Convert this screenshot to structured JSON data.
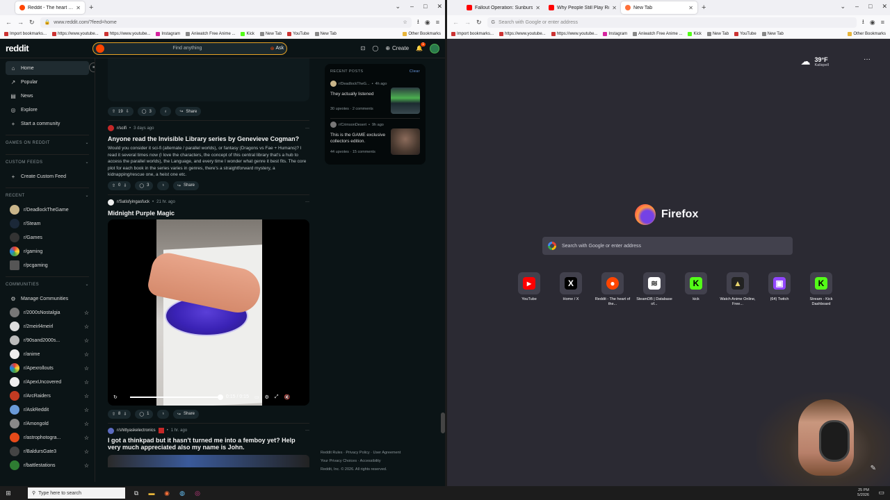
{
  "left_browser": {
    "tabs": [
      {
        "title": "Reddit - The heart of the internet",
        "active": true
      }
    ],
    "new_tab_symbol": "+",
    "url": "www.reddit.com/?feed=home",
    "bookmarks": [
      "Import bookmarks...",
      "https://www.youtube...",
      "https://www.youtube...",
      "Instagram",
      "Aniwatch Free Anime ...",
      "Kick",
      "New Tab",
      "YouTube",
      "New Tab"
    ],
    "other_bookmarks": "Other Bookmarks"
  },
  "reddit": {
    "logo": "reddit",
    "search_placeholder": "Find anything",
    "ask_label": "Ask",
    "create_label": "Create",
    "notif_count": "1",
    "sidebar": {
      "main": [
        "Home",
        "Popular",
        "News",
        "Explore",
        "Start a community"
      ],
      "games_header": "GAMES ON REDDIT",
      "custom_header": "CUSTOM FEEDS",
      "create_custom": "Create Custom Feed",
      "recent_header": "RECENT",
      "recent": [
        "r/DeadlockTheGame",
        "r/Steam",
        "r/Games",
        "r/gaming",
        "r/pcgaming"
      ],
      "communities_header": "COMMUNITIES",
      "manage": "Manage Communities",
      "communities": [
        "r/2000sNostalgia",
        "r/2meirl4meirl",
        "r/90sand2000s...",
        "r/anime",
        "r/Apexrollouts",
        "r/ApexUncovered",
        "r/ArcRaiders",
        "r/AskReddit",
        "r/Amongold",
        "r/astrophotogra...",
        "r/BaldursGate3",
        "r/battlestations"
      ]
    },
    "posts": [
      {
        "upvotes": "19",
        "comments": "3",
        "share": "Share"
      },
      {
        "sub": "r/scifi",
        "age": "3 days ago",
        "title": "Anyone read the Invisible Library series by Genevieve Cogman?",
        "body": "Would you consider it sci-fi (alternate / parallel worlds), or fantasy (Dragons vs Fae + Humans)? I read it several times now (I love the characters, the concept of this central library that's a hub to access the parallel worlds), the Language, and every time I wonder what genre it best fits. The core plot for each book in the series varies in genres, there's a straightforward mystery, a kidnapping/rescue one, a heist one etc.",
        "upvotes": "0",
        "comments": "3",
        "share": "Share"
      },
      {
        "sub": "r/Satisfyingasfuck",
        "age": "21 hr. ago",
        "title": "Midnight Purple Magic",
        "video_time": "0:15 / 0:15",
        "upvotes": "8",
        "comments": "1",
        "share": "Share"
      },
      {
        "sub": "r/shittyaskelectronics",
        "age": "1 hr. ago",
        "title": "I got a thinkpad but it hasn't turned me into a femboy yet? Help very much appreciated also my name is John."
      }
    ],
    "recent_posts": {
      "header": "RECENT POSTS",
      "clear": "Clear",
      "items": [
        {
          "sub": "r/DeadlockTheG...",
          "age": "4h ago",
          "title": "They actually listened",
          "upvotes": "30 upvotes",
          "comments": "2 comments"
        },
        {
          "sub": "r/CrimsonDesert",
          "age": "9h ago",
          "title": "This is the GAME exclusive collectors edition.",
          "upvotes": "44 upvotes",
          "comments": "15 comments"
        }
      ]
    },
    "footer": {
      "line1": "Reddit Rules · Privacy Policy · User Agreement",
      "line2": "Your Privacy Choices · Accessibility",
      "line3": "Reddit, Inc. © 2026. All rights reserved."
    }
  },
  "right_browser": {
    "tabs": [
      {
        "title": "Fallout Operation: Sunburst (Fa...",
        "active": false
      },
      {
        "title": "Why People Still Play Runescap...",
        "active": false
      },
      {
        "title": "New Tab",
        "active": true
      }
    ],
    "new_tab_symbol": "+",
    "url_placeholder": "Search with Google or enter address",
    "bookmarks": [
      "Import bookmarks...",
      "https://www.youtube...",
      "https://www.youtube...",
      "Instagram",
      "Aniwatch Free Anime ...",
      "Kick",
      "New Tab",
      "YouTube",
      "New Tab"
    ],
    "other_bookmarks": "Other Bookmarks",
    "weather": {
      "temp": "39°F",
      "location": "Kalispell"
    },
    "brand": "Firefox",
    "search_placeholder": "Search with Google or enter address",
    "shortcuts": [
      {
        "label": "YouTube",
        "color": "#ff0000",
        "glyph": "▶"
      },
      {
        "label": "Home / X",
        "color": "#000000",
        "glyph": "X"
      },
      {
        "label": "Reddit - The heart of the...",
        "color": "#ff4500",
        "glyph": "●"
      },
      {
        "label": "SteamDB | Database of...",
        "color": "#ffffff",
        "glyph": "≋"
      },
      {
        "label": "kick",
        "color": "#53fc18",
        "glyph": "K"
      },
      {
        "label": "Watch Anime Online, Free...",
        "color": "#222222",
        "glyph": "▲"
      },
      {
        "label": "(64) Twitch",
        "color": "#9146ff",
        "glyph": "▣"
      },
      {
        "label": "Stream - Kick Dashboard",
        "color": "#53fc18",
        "glyph": "K"
      }
    ]
  },
  "taskbar": {
    "search_placeholder": "Type here to search",
    "time": "25 PM",
    "date": "5/2026"
  }
}
